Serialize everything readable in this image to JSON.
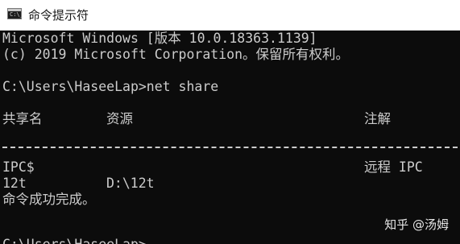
{
  "window": {
    "title": "命令提示符",
    "icon_text": "C:\\_"
  },
  "console": {
    "header_line1": "Microsoft Windows [版本 10.0.18363.1139]",
    "header_line2": "(c) 2019 Microsoft Corporation。保留所有权利。",
    "prompt_command": "C:\\Users\\HaseeLap>net share",
    "table": {
      "headers": {
        "share_name": "共享名",
        "resource": "资源",
        "remark": "注解"
      },
      "rows": [
        {
          "share_name": "IPC$",
          "resource": "",
          "remark": "远程 IPC"
        },
        {
          "share_name": "12t",
          "resource": "D:\\12t",
          "remark": ""
        }
      ]
    },
    "result_line": "命令成功完成。",
    "partial_next_prompt": "C:\\Users\\HaseeLap>"
  },
  "watermark": "知乎 @汤姆"
}
